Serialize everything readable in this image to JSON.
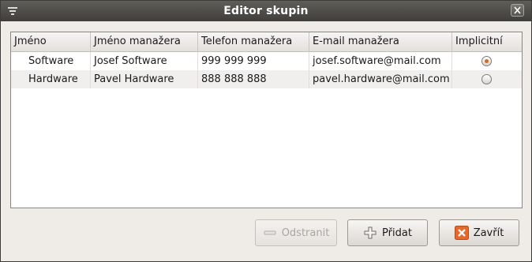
{
  "window": {
    "title": "Editor skupin"
  },
  "table": {
    "columns": [
      "Jméno",
      "Jméno manažera",
      "Telefon manažera",
      "E-mail manažera",
      "Implicitní"
    ],
    "rows": [
      {
        "name": "Software",
        "manager": "Josef Software",
        "phone": "999 999 999",
        "email": "josef.software@mail.com",
        "default": true
      },
      {
        "name": "Hardware",
        "manager": "Pavel Hardware",
        "phone": "888 888 888",
        "email": "pavel.hardware@mail.com",
        "default": false
      }
    ]
  },
  "buttons": {
    "remove": {
      "label": "Odstranit",
      "icon": "minus-icon",
      "enabled": false
    },
    "add": {
      "label": "Přidat",
      "icon": "plus-icon",
      "enabled": true
    },
    "close": {
      "label": "Zavřít",
      "icon": "close-x-icon",
      "enabled": true
    }
  },
  "colors": {
    "titlebar": "#3f3e3a",
    "accent": "#d36a2a",
    "close_icon_bg": "#e8672a"
  }
}
